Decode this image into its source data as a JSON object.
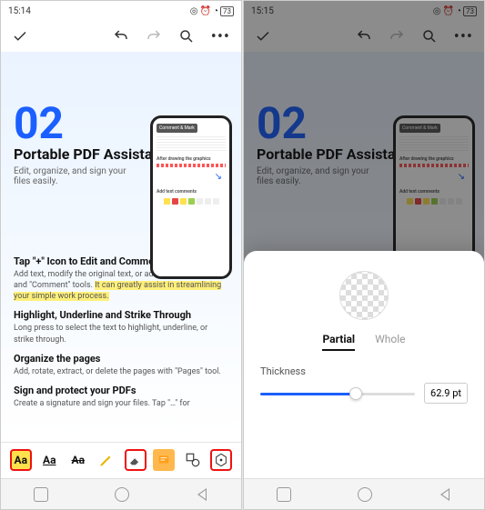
{
  "left": {
    "statusbar": {
      "time": "15:14",
      "battery": "73"
    },
    "page": {
      "number": "02",
      "title": "Portable PDF Assistant",
      "subtitle": "Edit, organize, and sign your files easily."
    },
    "mini": {
      "tag": "Comment & Mark",
      "h2": "After drawing the graphics",
      "h3": "Add text comments"
    },
    "features": {
      "f1": {
        "h": "Tap \"+\" Icon to Edit and Comment",
        "p_a": "Add text, modify the original text, or add notes with \"Edit\" and \"Comment\" tools. ",
        "p_hl": "It can greatly assist in streamlining your simple work process.",
        "p_b": ""
      },
      "f2": {
        "h": "Highlight, Underline and Strike Through",
        "p": "Long press to select the text to highlight, underline, or strike through."
      },
      "f3": {
        "h": "Organize the pages",
        "p": "Add, rotate, extract, or delete the pages with \"Pages\" tool."
      },
      "f4": {
        "h": "Sign and protect your PDFs",
        "p": "Create a signature and sign your files. Tap \"…\" for"
      }
    },
    "tools": {
      "aa": "Aa"
    }
  },
  "right": {
    "statusbar": {
      "time": "15:15",
      "battery": "73"
    },
    "sheet": {
      "tab_partial": "Partial",
      "tab_whole": "Whole",
      "thickness_label": "Thickness",
      "thickness_value": "62.9 pt"
    }
  }
}
